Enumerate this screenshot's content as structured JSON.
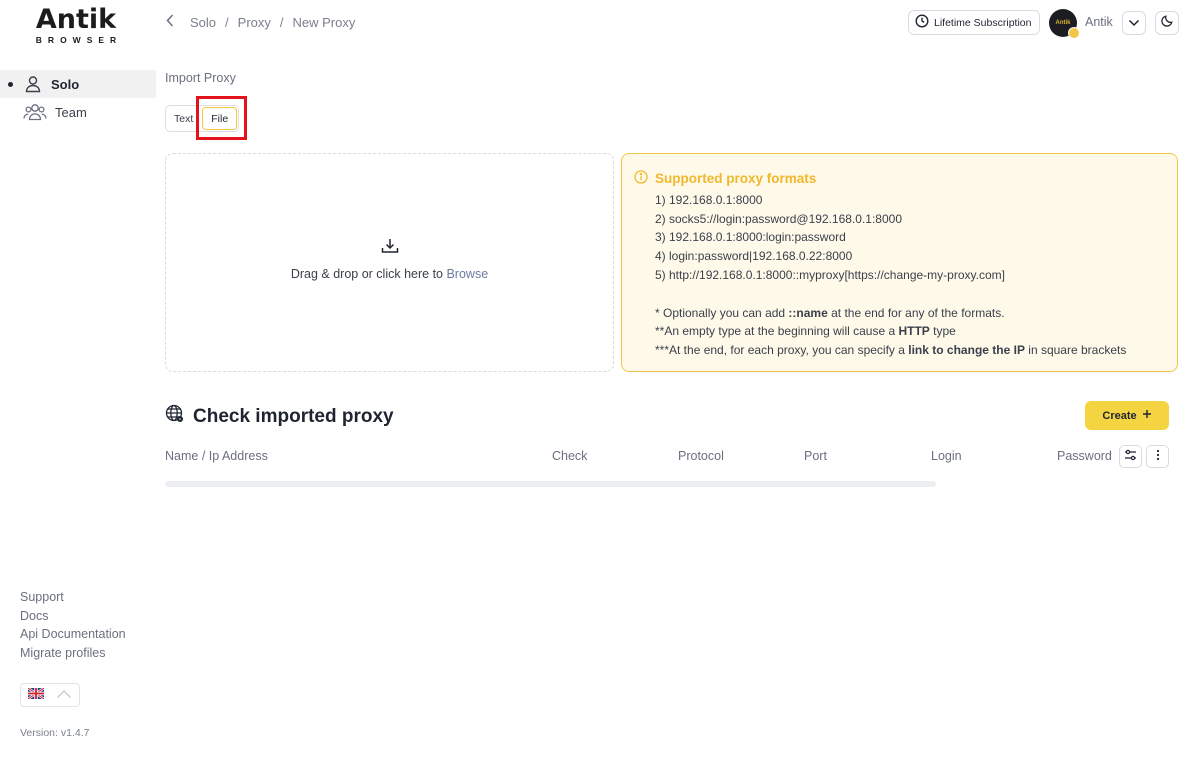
{
  "logo": {
    "main": "Antik",
    "sub": "BROWSER"
  },
  "sidebar": {
    "items": [
      {
        "label": "Solo",
        "icon": "user-icon",
        "active": true
      },
      {
        "label": "Team",
        "icon": "team-icon",
        "active": false
      }
    ],
    "footer_links": [
      "Support",
      "Docs",
      "Api Documentation",
      "Migrate profiles"
    ],
    "language_flag": "uk-flag-icon",
    "version": "Version: v1.4.7"
  },
  "header": {
    "breadcrumb": [
      "Solo",
      "Proxy",
      "New Proxy"
    ],
    "separator": "/",
    "subscription_label": "Lifetime Subscription",
    "user_name": "Antik",
    "avatar_text": "Antik"
  },
  "import": {
    "label": "Import Proxy",
    "tabs": [
      {
        "label": "Text",
        "active": false
      },
      {
        "label": "File",
        "active": true
      }
    ],
    "dropzone": {
      "text": "Drag & drop or click here to ",
      "link": "Browse"
    }
  },
  "formats": {
    "title": "Supported proxy formats",
    "items": [
      "1) 192.168.0.1:8000",
      "2) socks5://login:password@192.168.0.1:8000",
      "3) 192.168.0.1:8000:login:password",
      "4) login:password|192.168.0.22:8000",
      "5) http://192.168.0.1:8000::myproxy[https://change-my-proxy.com]"
    ],
    "note1": {
      "pre": "* Optionally you can add ",
      "bold": "::name",
      "post": " at the end for any of the formats."
    },
    "note2": {
      "pre": "**An empty type at the beginning will cause a ",
      "bold": "HTTP",
      "post": " type"
    },
    "note3": {
      "pre": "***At the end, for each proxy, you can specify a ",
      "bold": "link to change the IP",
      "post": " in square brackets"
    }
  },
  "check": {
    "title": "Check imported proxy",
    "create_label": "Create",
    "columns": [
      "Name / Ip Address",
      "Check",
      "Protocol",
      "Port",
      "Login",
      "Password"
    ]
  },
  "colors": {
    "accent": "#f5d442",
    "accent_border": "#f2c744",
    "formats_bg": "#fff9ea",
    "formats_title": "#f0b92d",
    "highlight": "#e3131c"
  }
}
